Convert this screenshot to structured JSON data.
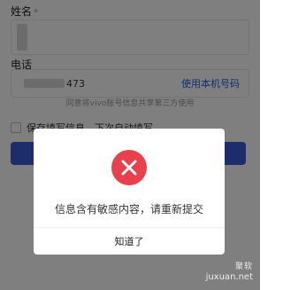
{
  "form": {
    "name_label": "姓名",
    "required_mark": "*",
    "phone_label": "电话",
    "phone_partial": "473",
    "use_phone_link": "使用本机号码",
    "consent_text": "同意将vivo账号信息共享第三方使用",
    "save_label": "保存填写信息，下次自动填写"
  },
  "dialog": {
    "icon": "close-icon",
    "message": "信息含有敏感内容，请重新提交",
    "ok_label": "知道了"
  },
  "colors": {
    "accent": "#1f62e0",
    "submit": "#3a5bd6",
    "error": "#e8414d",
    "overlay": "rgba(0,0,0,0.5)"
  },
  "watermark": {
    "line1": "聚软",
    "line2": "juxuan.net"
  }
}
